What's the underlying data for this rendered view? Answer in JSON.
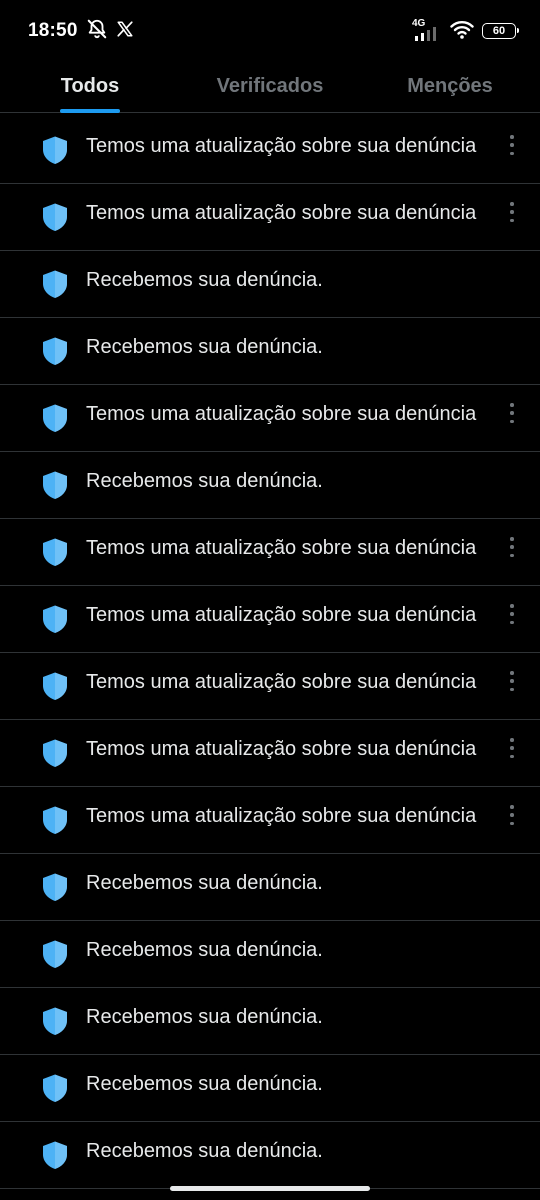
{
  "status_bar": {
    "time": "18:50",
    "network_type": "4G",
    "battery_level": "60",
    "icons": [
      "bell-muted-icon",
      "x-logo-icon",
      "cellular-signal-icon",
      "wifi-icon",
      "battery-icon"
    ]
  },
  "tabs": [
    {
      "label": "Todos",
      "active": true
    },
    {
      "label": "Verificados",
      "active": false
    },
    {
      "label": "Menções",
      "active": false
    }
  ],
  "colors": {
    "background": "#000000",
    "accent": "#1d9bf0",
    "shield": "#4db2f5",
    "text": "#e7e9ea",
    "muted": "#71767b",
    "divider": "#2f3336"
  },
  "notifications": [
    {
      "text": "Temos uma atualização sobre sua denúncia",
      "has_menu": true,
      "icon": "shield-icon"
    },
    {
      "text": "Temos uma atualização sobre sua denúncia",
      "has_menu": true,
      "icon": "shield-icon"
    },
    {
      "text": "Recebemos sua denúncia.",
      "has_menu": false,
      "icon": "shield-icon"
    },
    {
      "text": "Recebemos sua denúncia.",
      "has_menu": false,
      "icon": "shield-icon"
    },
    {
      "text": "Temos uma atualização sobre sua denúncia",
      "has_menu": true,
      "icon": "shield-icon"
    },
    {
      "text": "Recebemos sua denúncia.",
      "has_menu": false,
      "icon": "shield-icon"
    },
    {
      "text": "Temos uma atualização sobre sua denúncia",
      "has_menu": true,
      "icon": "shield-icon"
    },
    {
      "text": "Temos uma atualização sobre sua denúncia",
      "has_menu": true,
      "icon": "shield-icon"
    },
    {
      "text": "Temos uma atualização sobre sua denúncia",
      "has_menu": true,
      "icon": "shield-icon"
    },
    {
      "text": "Temos uma atualização sobre sua denúncia",
      "has_menu": true,
      "icon": "shield-icon"
    },
    {
      "text": "Temos uma atualização sobre sua denúncia",
      "has_menu": true,
      "icon": "shield-icon"
    },
    {
      "text": "Recebemos sua denúncia.",
      "has_menu": false,
      "icon": "shield-icon"
    },
    {
      "text": "Recebemos sua denúncia.",
      "has_menu": false,
      "icon": "shield-icon"
    },
    {
      "text": "Recebemos sua denúncia.",
      "has_menu": false,
      "icon": "shield-icon"
    },
    {
      "text": "Recebemos sua denúncia.",
      "has_menu": false,
      "icon": "shield-icon"
    },
    {
      "text": "Recebemos sua denúncia.",
      "has_menu": false,
      "icon": "shield-icon"
    }
  ]
}
